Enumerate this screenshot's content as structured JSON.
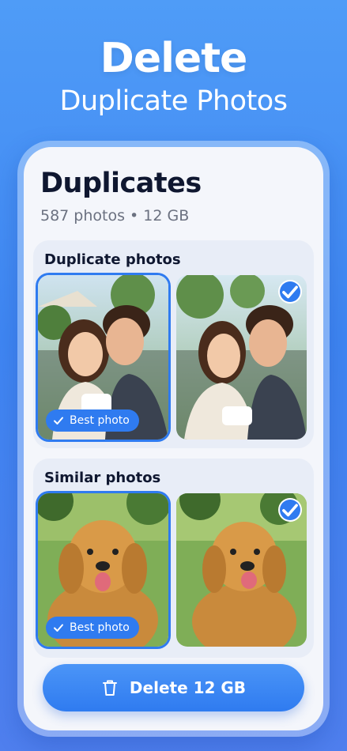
{
  "hero": {
    "title": "Delete",
    "subtitle": "Duplicate Photos"
  },
  "screen": {
    "title": "Duplicates",
    "subtitle": "587 photos • 12 GB"
  },
  "sections": [
    {
      "title": "Duplicate photos",
      "best_label": "Best photo",
      "photos": [
        {
          "subject": "couple-selfie-cafe",
          "best": true,
          "selected": false
        },
        {
          "subject": "couple-selfie-cafe",
          "best": false,
          "selected": true
        }
      ]
    },
    {
      "title": "Similar photos",
      "best_label": "Best photo",
      "photos": [
        {
          "subject": "golden-retriever-park",
          "best": true,
          "selected": false
        },
        {
          "subject": "golden-retriever-park",
          "best": false,
          "selected": true
        }
      ]
    }
  ],
  "delete_button": {
    "label": "Delete 12 GB",
    "icon": "trash-icon"
  },
  "colors": {
    "background": "#3f86f2",
    "accent": "#2f7bf0",
    "card": "#f4f6fb",
    "section": "#e8edf7",
    "text_dark": "#0f1730",
    "text_muted": "#6b7180"
  }
}
